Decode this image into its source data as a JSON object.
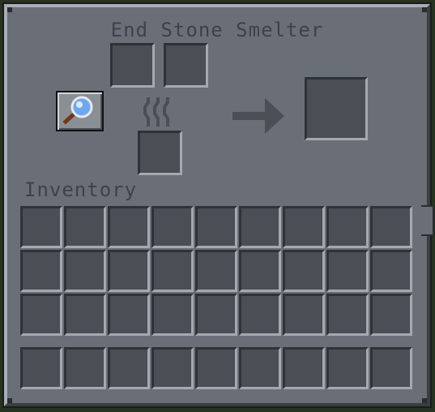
{
  "window": {
    "title": "End Stone Smelter",
    "inventory_label": "Inventory"
  },
  "machine": {
    "input_slots": 2,
    "fuel_slots": 1,
    "output_slots": 1,
    "button_icon": "magnifying-glass-icon",
    "progress_icon": "arrow-right-icon",
    "heat_icon": "heat-waves-icon"
  },
  "inventory": {
    "rows": 3,
    "columns": 9,
    "hotbar_slots": 9
  },
  "colors": {
    "panel": "#6a6f77",
    "slot": "#4a4e55",
    "text": "#3e4248"
  }
}
